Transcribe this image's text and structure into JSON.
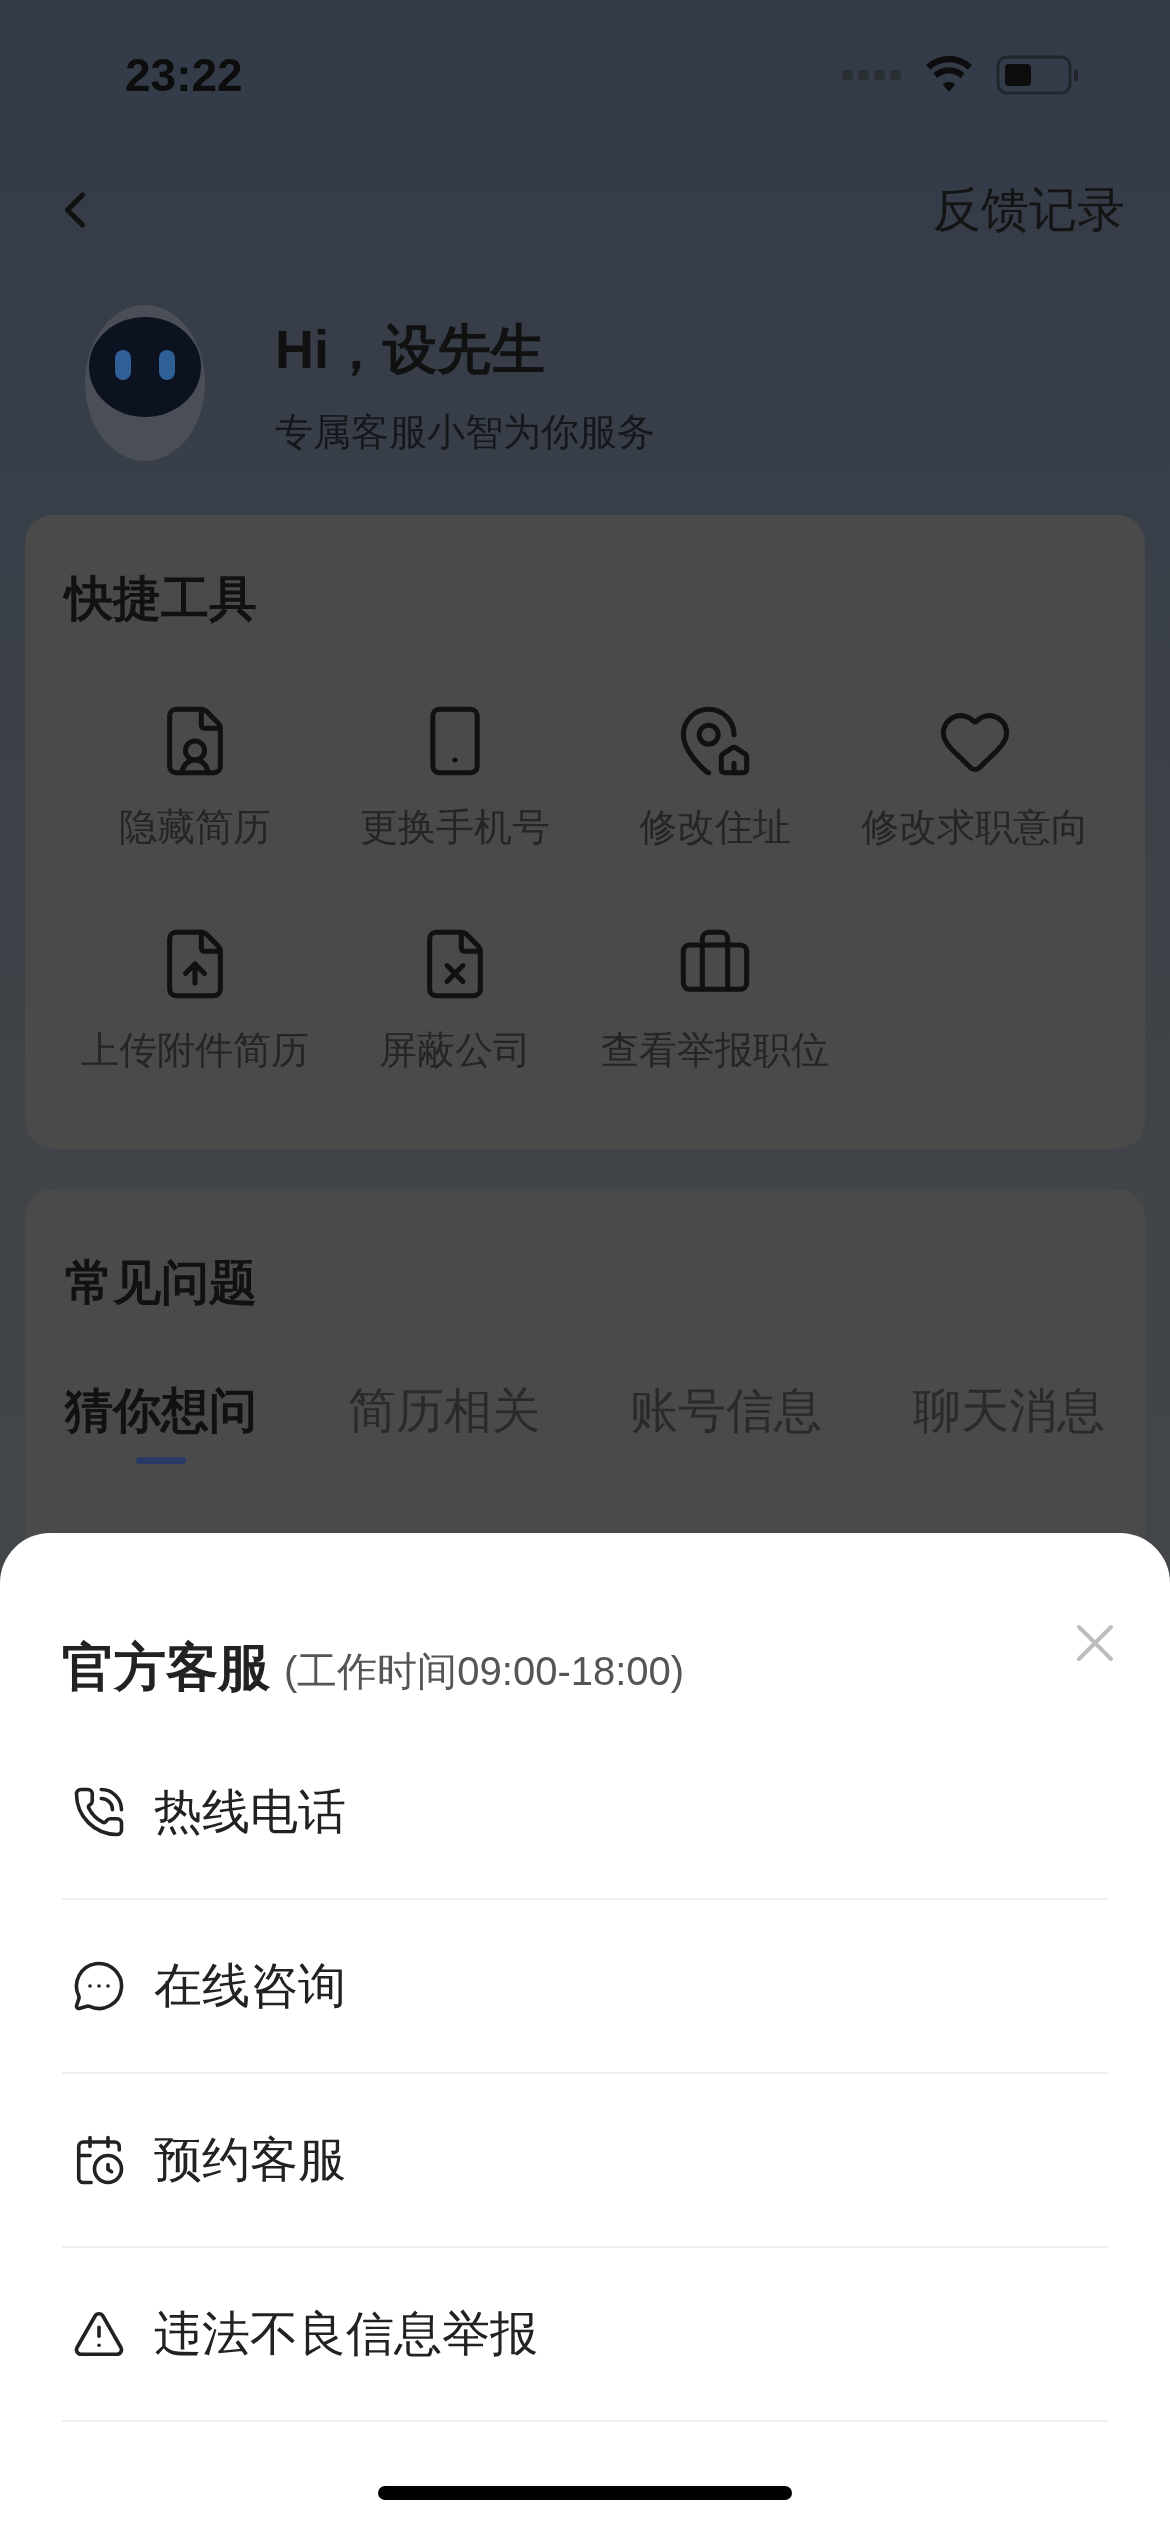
{
  "status_bar": {
    "time": "23:22"
  },
  "nav": {
    "action": "反馈记录"
  },
  "greeting": {
    "title": "Hi，设先生",
    "subtitle": "专属客服小智为你服务"
  },
  "quick_tools": {
    "title": "快捷工具",
    "items": [
      {
        "label": "隐藏简历"
      },
      {
        "label": "更换手机号"
      },
      {
        "label": "修改住址"
      },
      {
        "label": "修改求职意向"
      },
      {
        "label": "上传附件简历"
      },
      {
        "label": "屏蔽公司"
      },
      {
        "label": "查看举报职位"
      }
    ]
  },
  "faq": {
    "title": "常见问题",
    "tabs": [
      {
        "label": "猜你想问",
        "selected": true
      },
      {
        "label": "简历相关",
        "selected": false
      },
      {
        "label": "账号信息",
        "selected": false
      },
      {
        "label": "聊天消息",
        "selected": false
      }
    ]
  },
  "sheet": {
    "title": "官方客服",
    "hours": "(工作时间09:00-18:00)",
    "items": [
      {
        "label": "热线电话"
      },
      {
        "label": "在线咨询"
      },
      {
        "label": "预约客服"
      },
      {
        "label": "违法不良信息举报"
      }
    ]
  }
}
